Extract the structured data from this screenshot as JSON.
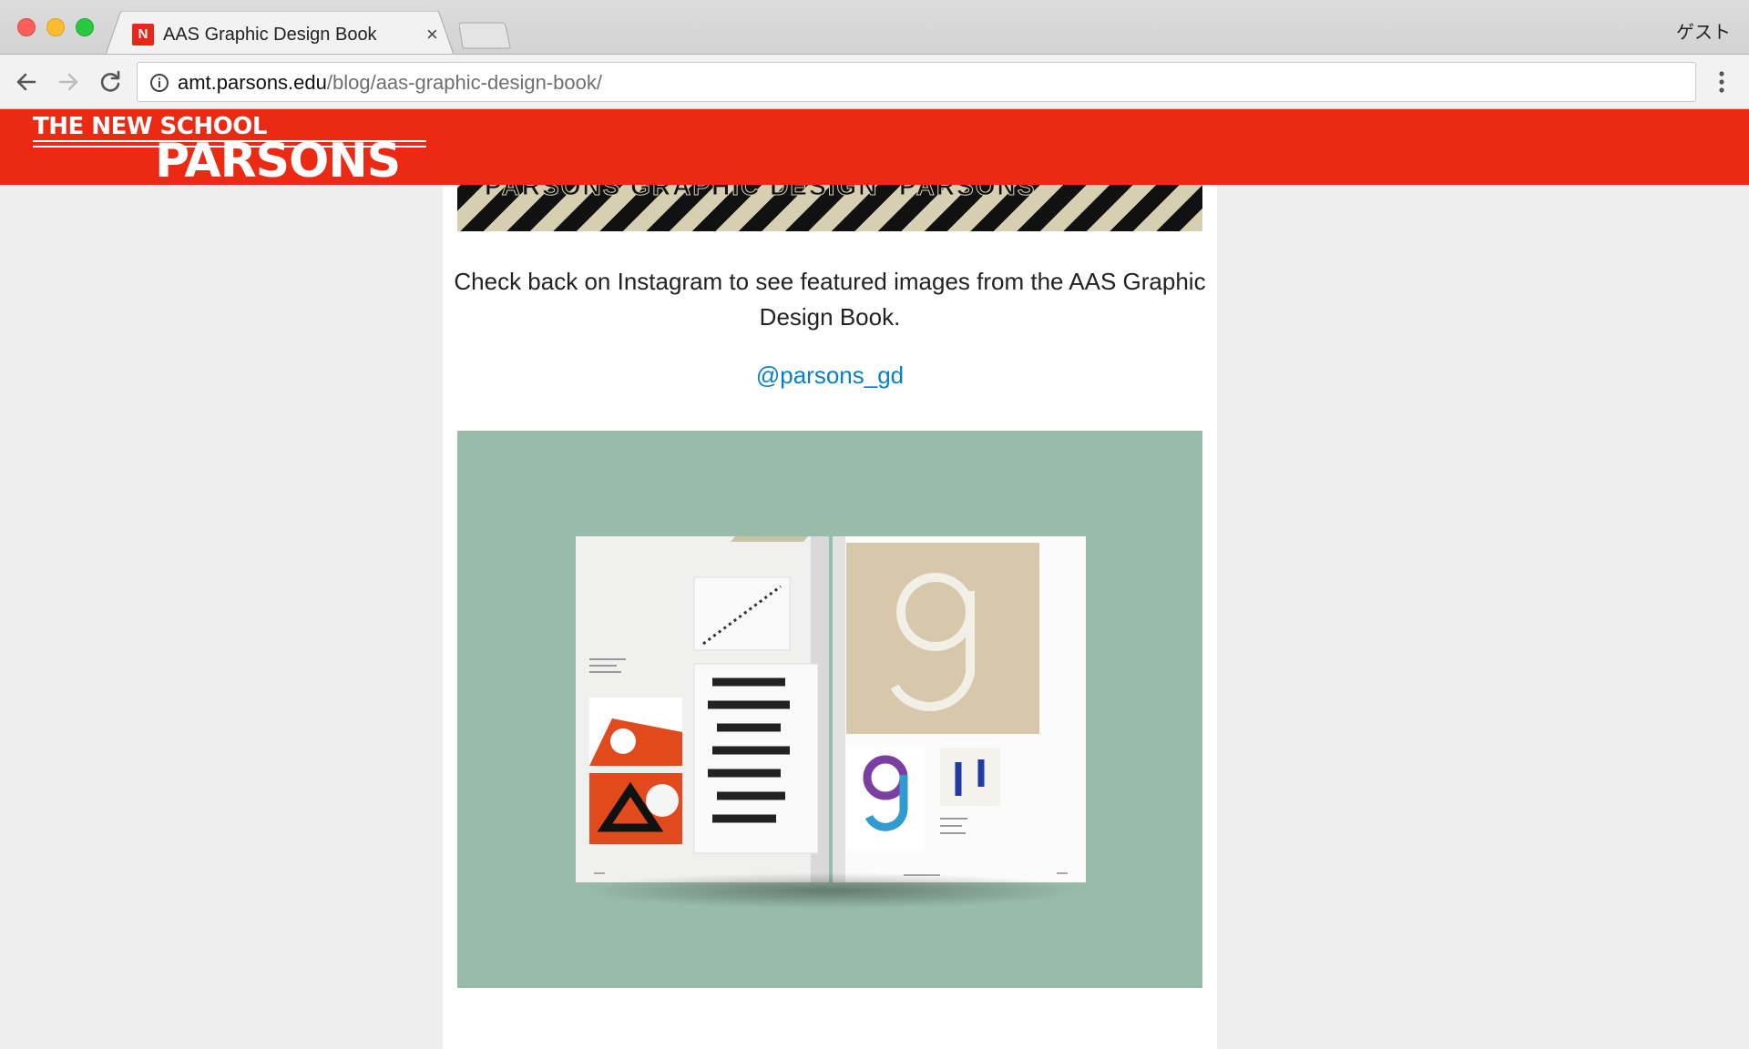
{
  "browser": {
    "tab_title": "AAS Graphic Design Book",
    "tab_favicon_letter": "N",
    "tab_close": "×",
    "profile": "ゲスト",
    "url_host": "amt.parsons.edu",
    "url_path": "/blog/aas-graphic-design-book/"
  },
  "site": {
    "logo_top": "THE NEW SCHOOL",
    "logo_main": "PARSONS",
    "brand_color": "#ea2a13"
  },
  "article": {
    "banner_text_left": "PARSONS GRAPHIC DESIGN",
    "banner_text_right": "PARSONS",
    "intro_text": "Check back on Instagram to see featured images from the AAS Graphic Design Book.",
    "instagram_handle": "@parsons_gd",
    "link_color": "#0a7fc8",
    "image_bg_color": "#99bcaa"
  }
}
